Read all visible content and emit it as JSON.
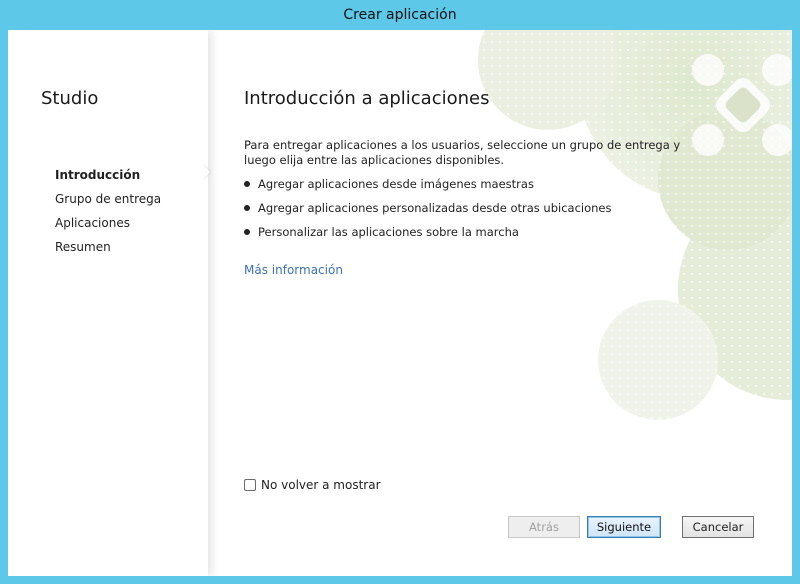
{
  "window": {
    "title": "Crear aplicación"
  },
  "sidebar": {
    "title": "Studio",
    "steps": [
      {
        "label": "Introducción",
        "active": true
      },
      {
        "label": "Grupo de entrega",
        "active": false
      },
      {
        "label": "Aplicaciones",
        "active": false
      },
      {
        "label": "Resumen",
        "active": false
      }
    ]
  },
  "main": {
    "title": "Introducción a aplicaciones",
    "intro": "Para entregar aplicaciones a los usuarios, seleccione un grupo de entrega y luego elija entre las aplicaciones disponibles.",
    "bullets": [
      "Agregar aplicaciones desde imágenes maestras",
      "Agregar aplicaciones personalizadas desde otras ubicaciones",
      "Personalizar las aplicaciones sobre la marcha"
    ],
    "more_info_link": "Más información",
    "dont_show_again": {
      "label": "No volver a mostrar",
      "checked": false
    }
  },
  "footer": {
    "back_label": "Atrás",
    "back_enabled": false,
    "next_label": "Siguiente",
    "cancel_label": "Cancelar"
  },
  "colors": {
    "window_frame": "#5ec8e8",
    "link": "#3a72b5",
    "decoration": "#dfe8cf"
  }
}
